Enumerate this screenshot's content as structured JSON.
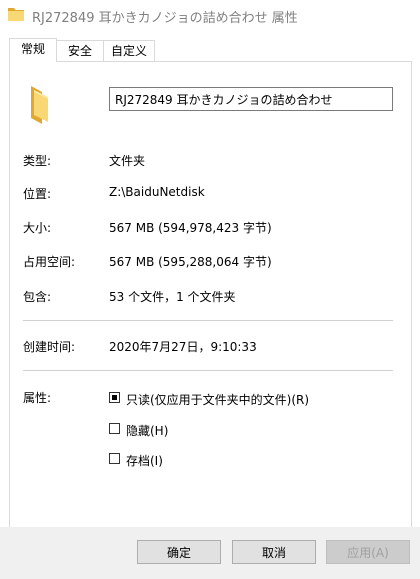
{
  "window": {
    "title": "RJ272849 耳かきカノジョの詰め合わせ 属性"
  },
  "tabs": [
    {
      "label": "常规",
      "active": true
    },
    {
      "label": "安全",
      "active": false
    },
    {
      "label": "自定义",
      "active": false
    }
  ],
  "general": {
    "folder_icon": "folder-icon",
    "name_value": "RJ272849 耳かきカノジョの詰め合わせ",
    "properties": [
      {
        "label": "类型:",
        "value": "文件夹"
      },
      {
        "label": "位置:",
        "value": "Z:\\BaiduNetdisk"
      },
      {
        "label": "大小:",
        "value": "567 MB (594,978,423 字节)"
      },
      {
        "label": "占用空间:",
        "value": "567 MB (595,288,064 字节)"
      },
      {
        "label": "包含:",
        "value": "53 个文件，1 个文件夹"
      }
    ],
    "created": {
      "label": "创建时间:",
      "value": "2020年7月27日，9:10:33"
    },
    "attributes": {
      "label": "属性:",
      "readonly": {
        "label": "只读(仅应用于文件夹中的文件)(R)",
        "state": "indeterminate"
      },
      "hidden": {
        "label": "隐藏(H)",
        "state": "unchecked"
      },
      "archive": {
        "label": "存档(I)",
        "state": "unchecked"
      }
    }
  },
  "buttons": {
    "ok": "确定",
    "cancel": "取消",
    "apply": "应用(A)"
  },
  "colors": {
    "folder_yellow": "#f8d775",
    "folder_dark": "#e0a82e",
    "panel_border": "#d9d9d9",
    "footer_bg": "#f0f0f0"
  }
}
